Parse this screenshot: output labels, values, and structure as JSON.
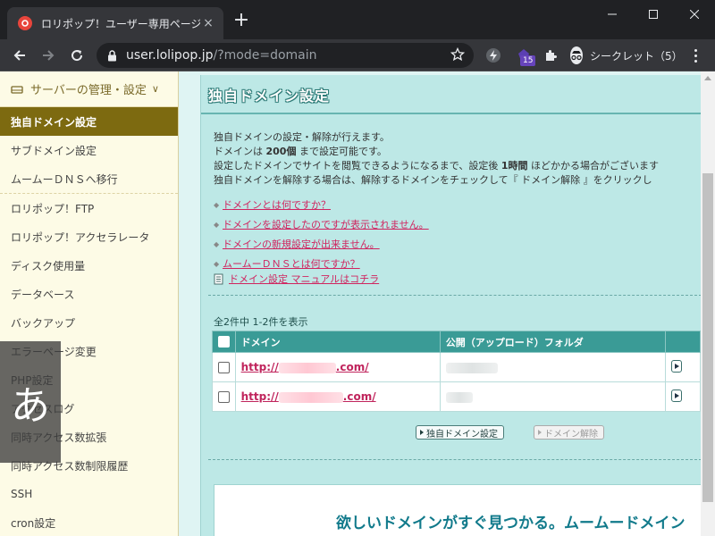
{
  "browser": {
    "tab_title": "ロリポップ！ユーザー専用ページ - 独自",
    "tab_close": "×",
    "new_tab": "+",
    "url_host": "user.lolipop.jp",
    "url_path": "/?mode=domain",
    "extension_badge": "15",
    "incognito_label": "シークレット（5）"
  },
  "sidebar": {
    "header": "サーバーの管理・設定",
    "header_chevron": "∨",
    "groups": [
      {
        "items": [
          {
            "label": "独自ドメイン設定",
            "active": true
          },
          {
            "label": "サブドメイン設定"
          },
          {
            "label": "ムームーＤＮＳへ移行"
          }
        ]
      },
      {
        "items": [
          {
            "label": "ロリポップ！FTP"
          },
          {
            "label": "ロリポップ！アクセラレータ"
          },
          {
            "label": "ディスク使用量"
          },
          {
            "label": "データベース"
          },
          {
            "label": "バックアップ"
          },
          {
            "label": "エラーページ変更"
          },
          {
            "label": "PHP設定"
          },
          {
            "label": "アクセスログ"
          },
          {
            "label": "同時アクセス数拡張"
          },
          {
            "label": "同時アクセス数制限履歴"
          },
          {
            "label": "SSH"
          },
          {
            "label": "cron設定"
          }
        ]
      }
    ],
    "ime_overlay": "あ"
  },
  "main": {
    "title": "独自ドメイン設定",
    "description": [
      {
        "pre": "独自ドメインの設定・解除が行えます。",
        "bold": "",
        "post": ""
      },
      {
        "pre": "ドメインは ",
        "bold": "200個",
        "post": " まで設定可能です。"
      },
      {
        "pre": "設定したドメインでサイトを閲覧できるようになるまで、設定後 ",
        "bold": "1時間",
        "post": " ほどかかる場合がございます"
      },
      {
        "pre": "独自ドメインを解除する場合は、解除するドメインをチェックして『 ドメイン解除 』をクリックし",
        "bold": "",
        "post": ""
      }
    ],
    "faq": [
      "ドメインとは何ですか？",
      "ドメインを設定したのですが表示されません。",
      "ドメインの新規設定が出来ません。",
      "ムームーＤＮＳとは何ですか？"
    ],
    "manual_link": "ドメイン設定 マニュアルはコチラ",
    "result_count": "全2件中 1-2件を表示",
    "table": {
      "headers": [
        "ドメイン",
        "公開（アップロード）フォルダ"
      ],
      "rows": [
        {
          "prefix": "http://",
          "suffix": ".com/"
        },
        {
          "prefix": "http://",
          "suffix": ".com/"
        }
      ]
    },
    "buttons": {
      "add": "独自ドメイン設定",
      "remove": "ドメイン解除"
    },
    "promo": "欲しいドメインがすぐ見つかる。ムームードメイン"
  },
  "colors": {
    "sidebar_active": "#7d6a10",
    "panel_bg": "#bde8e6",
    "table_header": "#3a9b96",
    "link": "#d0245f"
  }
}
